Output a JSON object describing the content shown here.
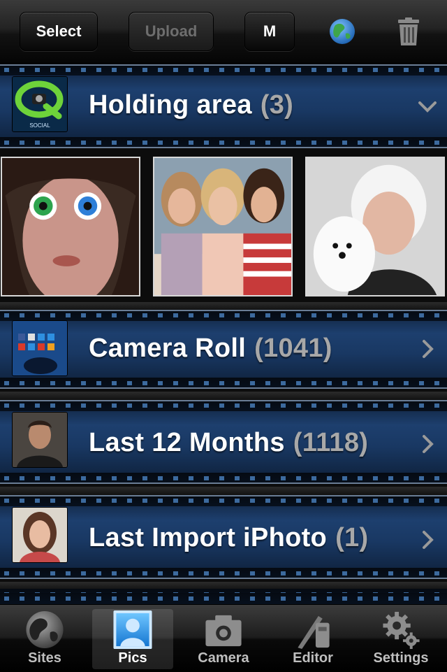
{
  "toolbar": {
    "select_label": "Select",
    "upload_label": "Upload",
    "m_label": "M",
    "globe_icon": "globe-icon",
    "trash_icon": "trash-icon"
  },
  "albums": [
    {
      "name": "Holding area",
      "count": "(3)",
      "thumb": "qsocial-logo",
      "arrow": "chevron-down-icon"
    },
    {
      "name": "Camera Roll",
      "count": "(1041)",
      "thumb": "app-screenshot",
      "arrow": "chevron-right-icon"
    },
    {
      "name": "Last 12 Months",
      "count": "(1118)",
      "thumb": "man-portrait",
      "arrow": "chevron-right-icon"
    },
    {
      "name": "Last Import iPhoto",
      "count": "(1)",
      "thumb": "girl-portrait",
      "arrow": "chevron-right-icon"
    }
  ],
  "holding_photos": [
    {
      "subject": "woman-with-colored-eyes"
    },
    {
      "subject": "three-women-group"
    },
    {
      "subject": "woman-with-poodle"
    }
  ],
  "thumb_logo_text": "SOCIAL",
  "tabs": [
    {
      "label": "Sites",
      "icon": "globe-icon",
      "active": false
    },
    {
      "label": "Pics",
      "icon": "person-icon",
      "active": true
    },
    {
      "label": "Camera",
      "icon": "camera-icon",
      "active": false
    },
    {
      "label": "Editor",
      "icon": "editor-icon",
      "active": false
    },
    {
      "label": "Settings",
      "icon": "gear-icon",
      "active": false
    }
  ],
  "colors": {
    "strip_blue": "#1d3f6e",
    "count_gray": "#a8a8a8",
    "active_tab_blue": "#2e8fe0"
  }
}
